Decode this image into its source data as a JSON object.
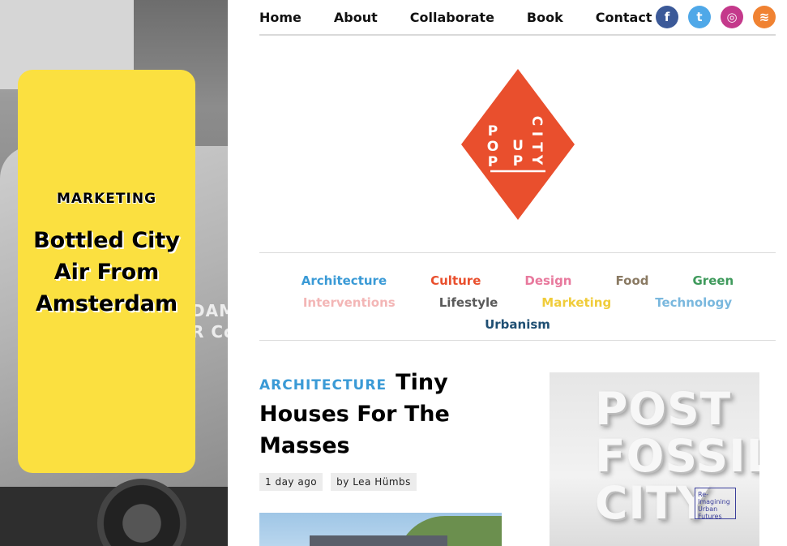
{
  "nav": {
    "items": [
      "Home",
      "About",
      "Collaborate",
      "Book",
      "Contact"
    ],
    "social": [
      {
        "icon": "facebook-icon",
        "glyph": "f",
        "color": "#3b5998"
      },
      {
        "icon": "twitter-icon",
        "glyph": "t",
        "color": "#4fa8e8"
      },
      {
        "icon": "instagram-icon",
        "glyph": "◎",
        "color": "#c4398b"
      },
      {
        "icon": "rss-icon",
        "glyph": "≋",
        "color": "#f08232"
      }
    ]
  },
  "logo": {
    "letters": [
      "P",
      "O",
      "P",
      "U",
      "P",
      "C",
      "I",
      "T",
      "Y"
    ],
    "color": "#e94f2d"
  },
  "hero": {
    "category": "MARKETING",
    "title": "Bottled City Air From Amsterdam",
    "truck_text": "DAM\nR Co",
    "card_color": "#fbe040"
  },
  "categories": {
    "rows": [
      [
        {
          "label": "Architecture",
          "color": "#3a9ad6"
        },
        {
          "label": "Culture",
          "color": "#e94f2d"
        },
        {
          "label": "Design",
          "color": "#e8799d"
        },
        {
          "label": "Food",
          "color": "#8a7a63"
        },
        {
          "label": "Green",
          "color": "#3f9a5c"
        }
      ],
      [
        {
          "label": "Interventions",
          "color": "#f3b6b6"
        },
        {
          "label": "Lifestyle",
          "color": "#5a5a5a"
        },
        {
          "label": "Marketing",
          "color": "#f0cc3a"
        },
        {
          "label": "Technology",
          "color": "#7ab8de"
        }
      ],
      [
        {
          "label": "Urbanism",
          "color": "#1f4f73"
        }
      ]
    ]
  },
  "article": {
    "category": "ARCHITECTURE",
    "title": "Tiny Houses For The Masses",
    "time": "1 day ago",
    "author": "by Lea Hümbs"
  },
  "side_image": {
    "lines": [
      "POST",
      "FOSSIL",
      "CITY"
    ],
    "tag": "Re-\nImagining\nUrban\nFutures"
  }
}
